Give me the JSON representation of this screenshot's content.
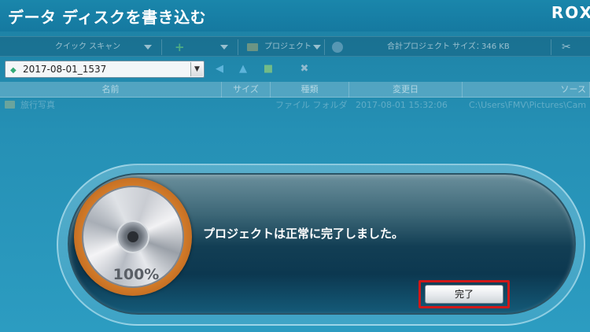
{
  "window": {
    "title": "データ ディスクを書き込む",
    "brand": "ROX"
  },
  "toolbar": {
    "quick_scan": "クイック スキャン",
    "project": "プロジェクト",
    "total_label": "合計プロジェクト サイズ：",
    "total_value": "346 KB"
  },
  "project_select": {
    "value": "2017-08-01_1537"
  },
  "table": {
    "columns": [
      "名前",
      "サイズ",
      "種類",
      "変更日",
      "ソース"
    ],
    "rows": [
      {
        "name": "旅行写真",
        "size": "",
        "type": "ファイル フォルダー",
        "modified": "2017-08-01 15:32:06",
        "source": "C:\\Users\\FMV\\Pictures\\Cam"
      }
    ]
  },
  "dialog": {
    "message": "プロジェクトは正常に完了しました。",
    "progress_text": "100%",
    "progress": 1.0,
    "done_button": "完了"
  },
  "colors": {
    "highlight": "#d01818",
    "background": "#2590b5"
  }
}
